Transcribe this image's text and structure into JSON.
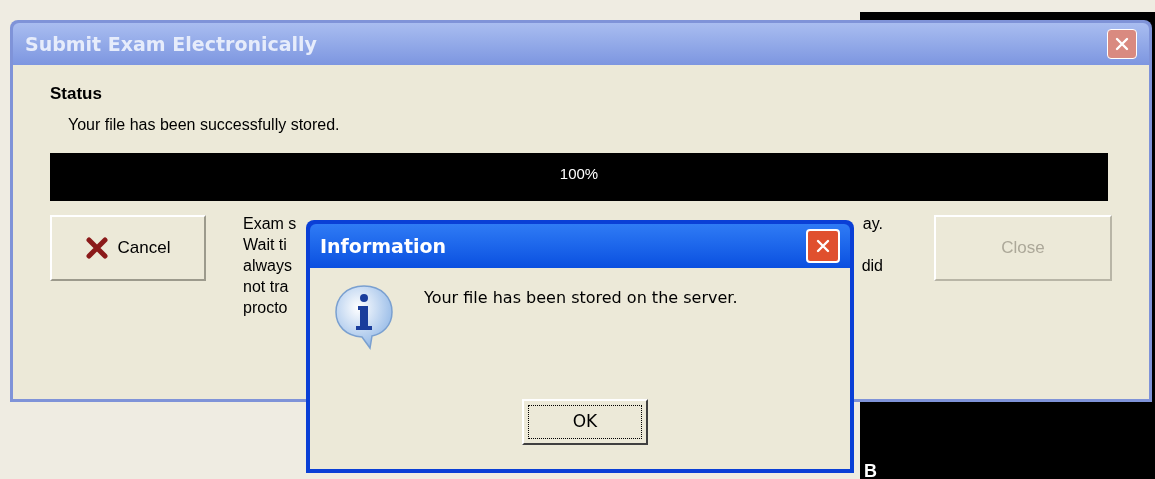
{
  "window": {
    "title": "Submit Exam Electronically"
  },
  "status": {
    "heading": "Status",
    "message": "Your file has been successfully stored."
  },
  "progress": {
    "level": 1,
    "reading": "100%"
  },
  "cancel_button": {
    "label": "Cancel",
    "disabled": false
  },
  "notes": [
    {
      "left": "Exam s",
      "right": "ay."
    },
    {
      "left": "Wait ti"
    },
    {
      "left": "always",
      "right": "did"
    },
    {
      "left": "not tra"
    },
    {
      "left": "procto"
    }
  ],
  "close_button": {
    "label": "Close",
    "disabled": true
  },
  "dialog": {
    "title": "Information",
    "message": "Your file has been stored on the server.",
    "ok_button": "OK"
  },
  "background_window": {
    "text": "B"
  }
}
